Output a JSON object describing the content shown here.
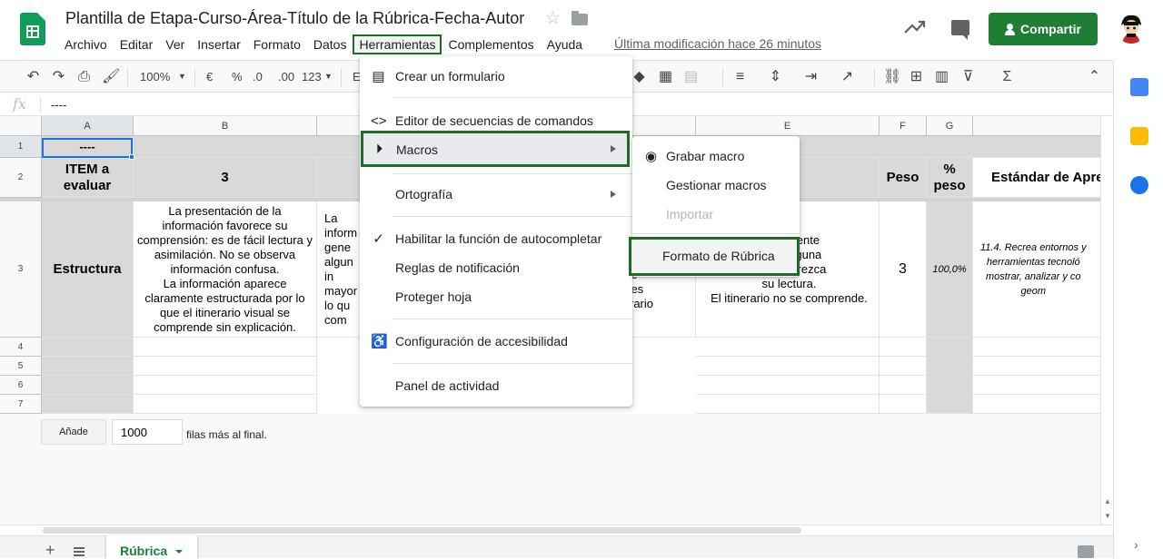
{
  "header": {
    "title": "Plantilla de Etapa-Curso-Área-Título de la Rúbrica-Fecha-Autor",
    "menus": [
      "Archivo",
      "Editar",
      "Ver",
      "Insertar",
      "Formato",
      "Datos",
      "Herramientas",
      "Complementos",
      "Ayuda"
    ],
    "active_menu": "Herramientas",
    "last_edit": "Última modificación hace 26 minutos",
    "share_label": "Compartir",
    "accent": "#1e7e34"
  },
  "toolbar": {
    "zoom": "100%",
    "currency": "€",
    "percent": "%",
    "decimals_less": ".0",
    "decimals_more": ".00",
    "number_format": "123",
    "font_partial": "E"
  },
  "formula_bar": {
    "fx": "fx",
    "value": "----"
  },
  "grid": {
    "columns": [
      "A",
      "B",
      "",
      "",
      "E",
      "F",
      "G",
      ""
    ],
    "rows": [
      "1",
      "2",
      "3",
      "4",
      "5",
      "6",
      "7"
    ],
    "a1": "----",
    "a2": "ITEM a evaluar",
    "b2": "3",
    "f2": "Peso",
    "g2": "% peso",
    "h2": "Estándar de Apre",
    "a3": "Estructura",
    "b3": "La presentación de la información favorece su comprensión: es de fácil lectura y asimilación. No se observa información confusa.\nLa información aparece claramente estructurada por lo que el itinerario visual se comprende sin explicación.",
    "c3": "La\ninform\ngene\nalgun\nin\nmayor\nlo qu\ncom",
    "d3": "arece\nque es\nitinerario\nerlo.",
    "e3": "s altamente\nndo ninguna\nque favorezca\nsu lectura.\nEl itinerario no se comprende.",
    "f3": "3",
    "g3": "100,0%",
    "h3": "11.4. Recrea entornos y\nherramientas tecnoló\nmostrar, analizar y co\ngeom"
  },
  "add_rows": {
    "button": "Añade",
    "count": "1000",
    "suffix": "filas más al final."
  },
  "sheet_tab": "Rúbrica",
  "tools_menu": {
    "items": [
      {
        "label": "Crear un formulario",
        "icon": "form-icon"
      },
      {
        "label": "Editor de secuencias de comandos",
        "icon": "code-icon"
      },
      {
        "label": "Macros",
        "icon": "play-circle-icon",
        "submenu": true
      },
      {
        "label": "Ortografía",
        "submenu": true
      },
      {
        "label": "Habilitar la función de autocompletar",
        "icon": "check-icon"
      },
      {
        "label": "Reglas de notificación"
      },
      {
        "label": "Proteger hoja"
      },
      {
        "label": "Configuración de accesibilidad",
        "icon": "accessibility-icon"
      },
      {
        "label": "Panel de actividad"
      }
    ]
  },
  "macros_menu": {
    "items": [
      {
        "label": "Grabar macro",
        "icon": "record-icon"
      },
      {
        "label": "Gestionar macros"
      },
      {
        "label": "Importar",
        "disabled": true
      },
      {
        "label": "Formato de Rúbrica"
      }
    ]
  }
}
